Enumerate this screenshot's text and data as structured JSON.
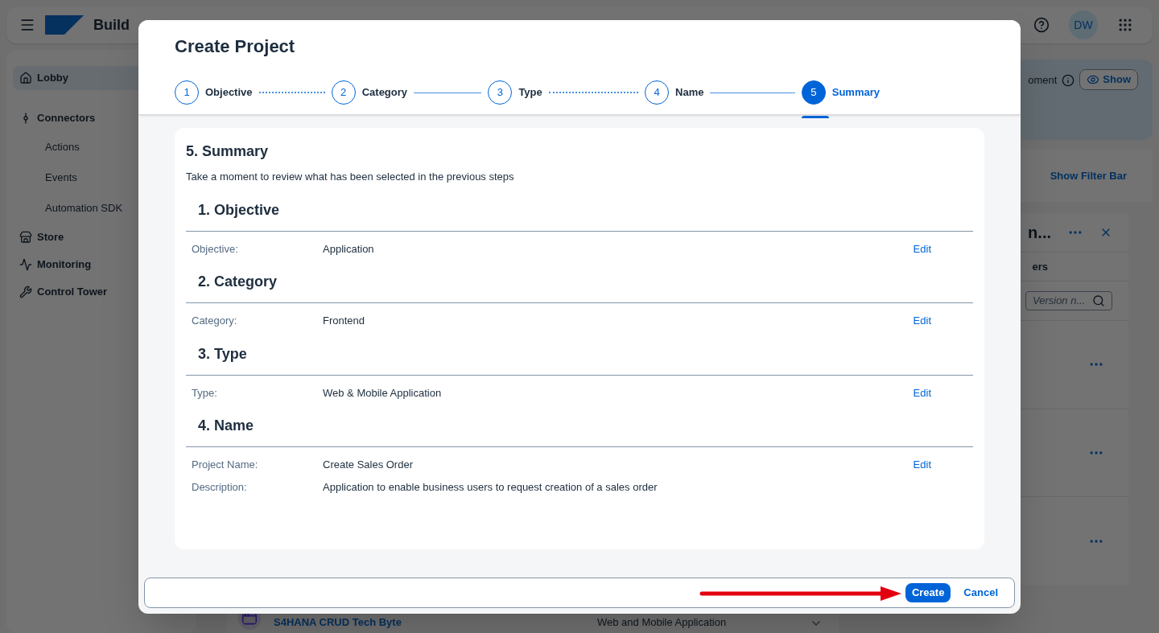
{
  "app": {
    "brand": "Build",
    "avatar": "DW"
  },
  "sidebar": {
    "items": [
      {
        "label": "Lobby",
        "selected": true
      },
      {
        "label": "Connectors",
        "selected": false,
        "children": [
          {
            "label": "Actions",
            "selected": false
          },
          {
            "label": "Events",
            "selected": false
          },
          {
            "label": "Automation SDK",
            "selected": false
          }
        ]
      },
      {
        "label": "Store",
        "selected": false
      },
      {
        "label": "Monitoring",
        "selected": false
      },
      {
        "label": "Control Tower",
        "selected": false
      }
    ]
  },
  "banner": {
    "text": "oment",
    "button": "Show"
  },
  "filter_link": "Show Filter Bar",
  "side_panel": {
    "title": "n...",
    "tab": "ers",
    "search_placeholder": "Version n..."
  },
  "project_row": {
    "name": "S4HANA CRUD Tech Byte",
    "type": "Web and Mobile Application"
  },
  "dialog": {
    "title": "Create Project",
    "steps": [
      {
        "number": "1",
        "label": "Objective",
        "selected": false,
        "dotted": true
      },
      {
        "number": "2",
        "label": "Category",
        "selected": false,
        "dotted": false
      },
      {
        "number": "3",
        "label": "Type",
        "selected": false,
        "dotted": true
      },
      {
        "number": "4",
        "label": "Name",
        "selected": false,
        "dotted": false
      },
      {
        "number": "5",
        "label": "Summary",
        "selected": true
      }
    ],
    "summary": {
      "heading": "5. Summary",
      "intro": "Take a moment to review what has been selected in the previous steps",
      "sections": [
        {
          "title": "1. Objective",
          "edit": "Edit",
          "fields": [
            {
              "label": "Objective:",
              "value": "Application"
            }
          ]
        },
        {
          "title": "2. Category",
          "edit": "Edit",
          "fields": [
            {
              "label": "Category:",
              "value": "Frontend"
            }
          ]
        },
        {
          "title": "3. Type",
          "edit": "Edit",
          "fields": [
            {
              "label": "Type:",
              "value": "Web & Mobile Application"
            }
          ]
        },
        {
          "title": "4. Name",
          "edit": "Edit",
          "fields": [
            {
              "label": "Project Name:",
              "value": "Create Sales Order"
            },
            {
              "label": "Description:",
              "value": "Application to enable business users to request creation of a sales order"
            }
          ]
        }
      ]
    },
    "footer": {
      "create": "Create",
      "cancel": "Cancel"
    }
  }
}
